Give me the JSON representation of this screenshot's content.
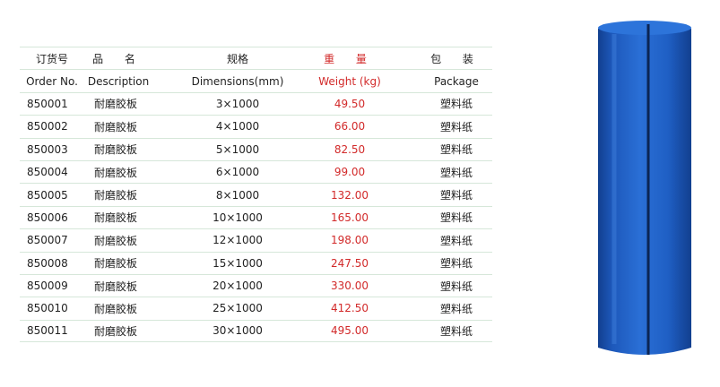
{
  "table": {
    "header_zh": [
      "订货号",
      "品 名",
      "规格",
      "重 量",
      "包 装"
    ],
    "header_en": [
      "Order No.",
      "Description",
      "Dimensions(mm)",
      "Weight (kg)",
      "Package"
    ],
    "rows": [
      [
        "850001",
        "耐磨胶板",
        "3×1000",
        "49.50",
        "塑料纸"
      ],
      [
        "850002",
        "耐磨胶板",
        "4×1000",
        "66.00",
        "塑料纸"
      ],
      [
        "850003",
        "耐磨胶板",
        "5×1000",
        "82.50",
        "塑料纸"
      ],
      [
        "850004",
        "耐磨胶板",
        "6×1000",
        "99.00",
        "塑料纸"
      ],
      [
        "850005",
        "耐磨胶板",
        "8×1000",
        "132.00",
        "塑料纸"
      ],
      [
        "850006",
        "耐磨胶板",
        "10×1000",
        "165.00",
        "塑料纸"
      ],
      [
        "850007",
        "耐磨胶板",
        "12×1000",
        "198.00",
        "塑料纸"
      ],
      [
        "850008",
        "耐磨胶板",
        "15×1000",
        "247.50",
        "塑料纸"
      ],
      [
        "850009",
        "耐磨胶板",
        "20×1000",
        "330.00",
        "塑料纸"
      ],
      [
        "850010",
        "耐磨胶板",
        "25×1000",
        "412.50",
        "塑料纸"
      ],
      [
        "850011",
        "耐磨胶板",
        "30×1000",
        "495.00",
        "塑料纸"
      ]
    ]
  },
  "colors": {
    "weight_text": "#d22a2a",
    "rule_line": "#d6e7d9",
    "roll_blue": "#1f5fc4"
  },
  "product_image": "blue-rubber-sheet-roll"
}
